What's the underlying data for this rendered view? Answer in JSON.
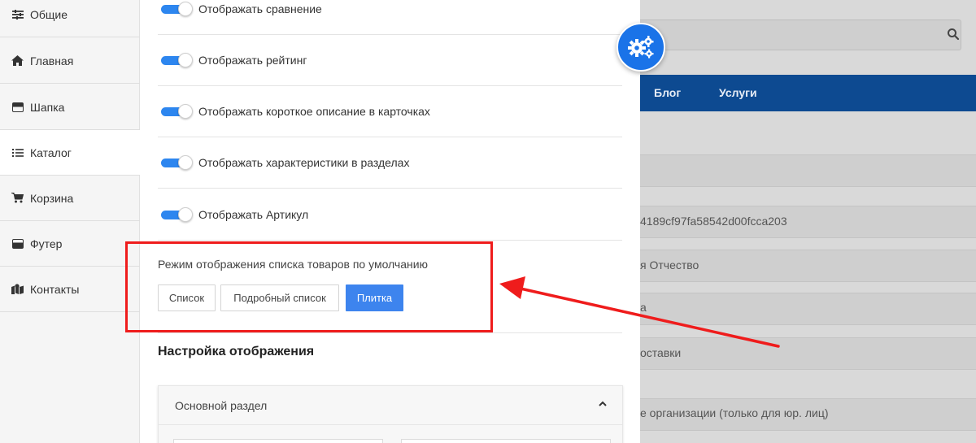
{
  "sidebar": {
    "items": [
      {
        "label": "Общие",
        "icon": "sliders-icon"
      },
      {
        "label": "Главная",
        "icon": "home-icon"
      },
      {
        "label": "Шапка",
        "icon": "header-icon"
      },
      {
        "label": "Каталог",
        "icon": "list-icon"
      },
      {
        "label": "Корзина",
        "icon": "cart-icon"
      },
      {
        "label": "Футер",
        "icon": "footer-icon"
      },
      {
        "label": "Контакты",
        "icon": "map-icon"
      }
    ],
    "active_index": 3
  },
  "panel": {
    "toggles": [
      {
        "label": "Отображать сравнение",
        "on": true
      },
      {
        "label": "Отображать рейтинг",
        "on": true
      },
      {
        "label": "Отображать короткое описание в карточках",
        "on": true
      },
      {
        "label": "Отображать характеристики в разделах",
        "on": true
      },
      {
        "label": "Отображать Артикул",
        "on": true
      }
    ],
    "view_mode": {
      "title": "Режим отображения списка товаров по умолчанию",
      "options": [
        "Список",
        "Подробный список",
        "Плитка"
      ],
      "selected": "Плитка"
    },
    "display_settings_title": "Настройка отображения",
    "accordion": {
      "title": "Основной раздел",
      "expanded": true
    }
  },
  "background": {
    "nav": [
      "Блог",
      "Услуги"
    ],
    "rows": [
      "4189cf97fa58542d00fcca203",
      "я Отчество",
      "а",
      "оставки",
      "е организации (только для юр. лиц)"
    ]
  },
  "colors": {
    "accent": "#3d84ee",
    "toggle": "#2d86ef",
    "nav": "#0d4a91",
    "annotation": "#ef1c1c"
  }
}
